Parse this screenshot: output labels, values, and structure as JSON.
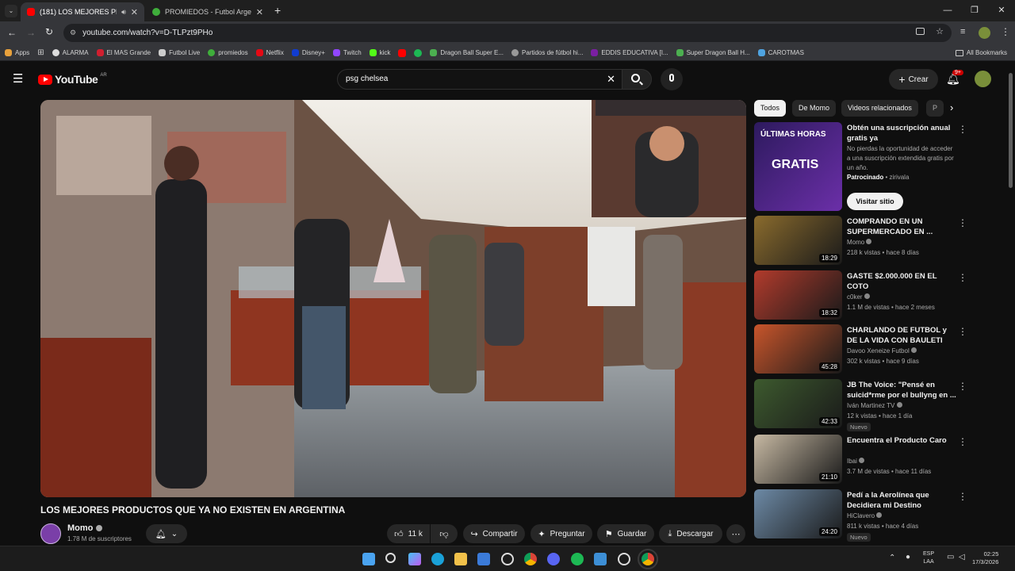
{
  "browser": {
    "tabs": [
      {
        "label": "(181) LOS MEJORES PRODU",
        "active": true
      },
      {
        "label": "PROMIEDOS - Futbol Argentino",
        "active": false
      }
    ],
    "new_tab": "+",
    "url": "youtube.com/watch?v=D-TLPzt9PHo",
    "bookmarks": [
      "Apps",
      "ALARMA",
      "El MAS Grande",
      "Futbol Live",
      "promiedos",
      "Netflix",
      "Disney+",
      "Twitch",
      "kick",
      "Dragon Ball Super E...",
      "Partidos de fútbol hi...",
      "EDDIS EDUCATIVA [I...",
      "Super Dragon Ball H...",
      "CAROTMAS"
    ],
    "all_bookmarks": "All Bookmarks"
  },
  "youtube": {
    "logo": "YouTube",
    "region": "AR",
    "search_value": "psg chelsea",
    "create": "Crear",
    "notif_count": "9+"
  },
  "video": {
    "title": "LOS MEJORES PRODUCTOS QUE YA NO EXISTEN EN ARGENTINA",
    "channel": "Momo",
    "subscribers": "1.78 M de suscriptores",
    "likes": "11 k",
    "share": "Compartir",
    "ask": "Preguntar",
    "save": "Guardar",
    "download": "Descargar"
  },
  "chips": [
    "Todos",
    "De Momo",
    "Videos relacionados",
    "P"
  ],
  "ad": {
    "title": "Obtén una suscripción anual gratis ya",
    "description": "No pierdas la oportunidad de acceder a una suscripción extendida gratis por un año.",
    "sponsor": "Patrocinado",
    "advertiser": "zirivala",
    "cta": "Visitar sitio",
    "thumb_text1": "ÚLTIMAS HORAS",
    "thumb_text2": "GRATIS"
  },
  "recommendations": [
    {
      "title": "COMPRANDO EN UN SUPERMERCADO EN ...",
      "channel": "Momo",
      "meta": "218 k vistas • hace 8 días",
      "duration": "18:29",
      "badge": "",
      "color": "#8a6b2d"
    },
    {
      "title": "GASTE $2.000.000 EN EL COTO",
      "channel": "c0ker",
      "meta": "1.1 M de vistas • hace 2 meses",
      "duration": "18:32",
      "badge": "",
      "color": "#b23b2c"
    },
    {
      "title": "CHARLANDO DE FUTBOL y DE LA VIDA CON BAULETI",
      "channel": "Davoo Xeneize Futbol",
      "meta": "302 k vistas • hace 9 días",
      "duration": "45:28",
      "badge": "",
      "color": "#c8552b"
    },
    {
      "title": "JB The Voice: \"Pensé en suicid*rme por el bullyng en ...",
      "channel": "Iván Martinez TV",
      "meta": "12 k vistas • hace 1 día",
      "duration": "42:33",
      "badge": "Nuevo",
      "color": "#3d5a2e"
    },
    {
      "title": "Encuentra el Producto Caro",
      "channel": "Ibai",
      "meta": "3.7 M de vistas • hace 11 días",
      "duration": "21:10",
      "badge": "",
      "color": "#c7b9a3"
    },
    {
      "title": "Pedí a la Aerolínea que Decidiera mi Destino",
      "channel": "HiClavero",
      "meta": "811 k vistas • hace 4 días",
      "duration": "24:20",
      "badge": "Nuevo",
      "color": "#6d8aa6"
    }
  ],
  "taskbar": {
    "lang1": "ESP",
    "lang2": "LAA",
    "time": "02:25",
    "date": "17/3/2026"
  }
}
